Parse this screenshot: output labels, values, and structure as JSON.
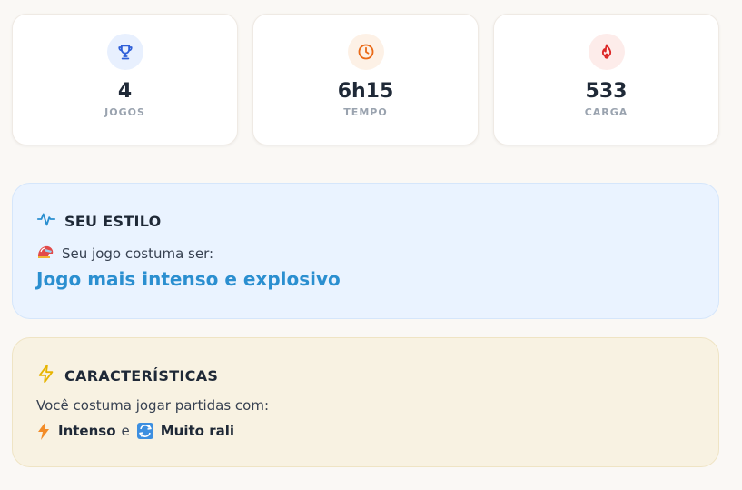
{
  "stats": [
    {
      "value": "4",
      "label": "JOGOS",
      "icon": "trophy-icon",
      "icon_color": "#2f5fd8",
      "icon_bg": "#e8f0fe"
    },
    {
      "value": "6h15",
      "label": "TEMPO",
      "icon": "clock-icon",
      "icon_color": "#ea6a17",
      "icon_bg": "#fdf1e6"
    },
    {
      "value": "533",
      "label": "CARGA",
      "icon": "flame-icon",
      "icon_color": "#dc2626",
      "icon_bg": "#fdecea"
    }
  ],
  "style": {
    "title": "SEU ESTILO",
    "icon": "activity-icon",
    "subtitle": "Seu jogo costuma ser:",
    "subtitle_icon": "helmet-icon",
    "value": "Jogo mais intenso e explosivo"
  },
  "traits": {
    "title": "CARACTERÍSTICAS",
    "icon": "lightning-icon",
    "subtitle": "Você costuma jogar partidas com:",
    "items": [
      {
        "label": "Intenso",
        "icon": "lightning-emoji-icon"
      },
      {
        "label": "Muito rali",
        "icon": "repeat-emoji-icon"
      }
    ],
    "connector": "e"
  },
  "colors": {
    "background": "#faf8f5",
    "accent_blue": "#2b8fd0",
    "style_card_bg": "#eaf3ff",
    "traits_card_bg": "#f8f2e2"
  }
}
